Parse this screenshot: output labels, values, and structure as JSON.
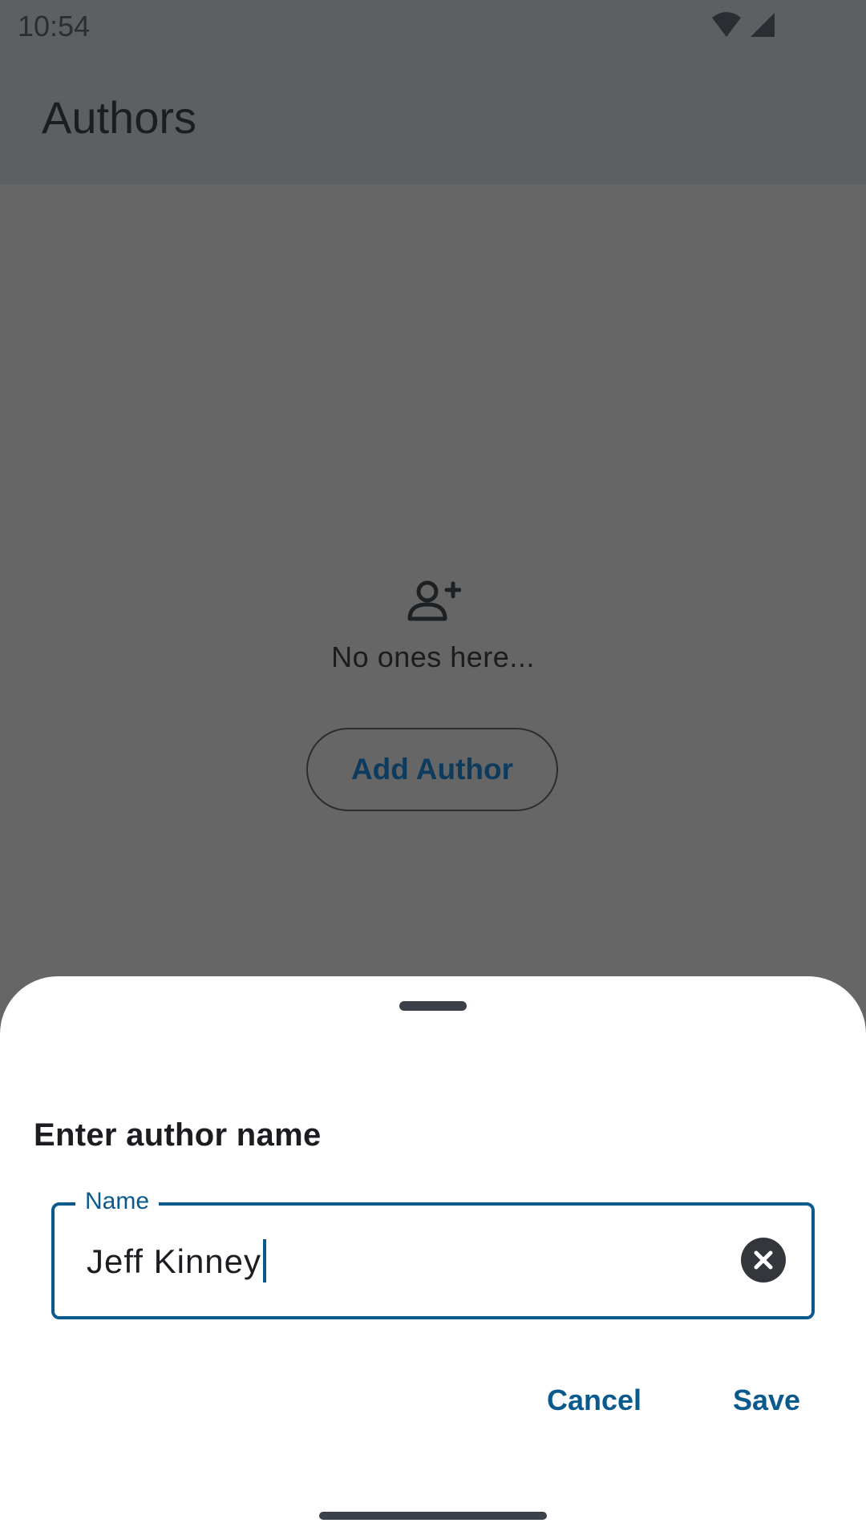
{
  "status_bar": {
    "time": "10:54",
    "icons": [
      "wifi-icon",
      "cell-signal-icon"
    ]
  },
  "app_bar": {
    "title": "Authors"
  },
  "empty_state": {
    "icon": "person-add-icon",
    "message": "No ones here...",
    "add_button_label": "Add Author"
  },
  "dialog": {
    "title": "Enter author name",
    "field": {
      "label": "Name",
      "value": "Jeff Kinney",
      "clear_icon": "clear-icon"
    },
    "cancel_label": "Cancel",
    "save_label": "Save"
  },
  "colors": {
    "accent": "#0b5a8e",
    "scrim": "#666666",
    "surface": "#ffffff"
  }
}
